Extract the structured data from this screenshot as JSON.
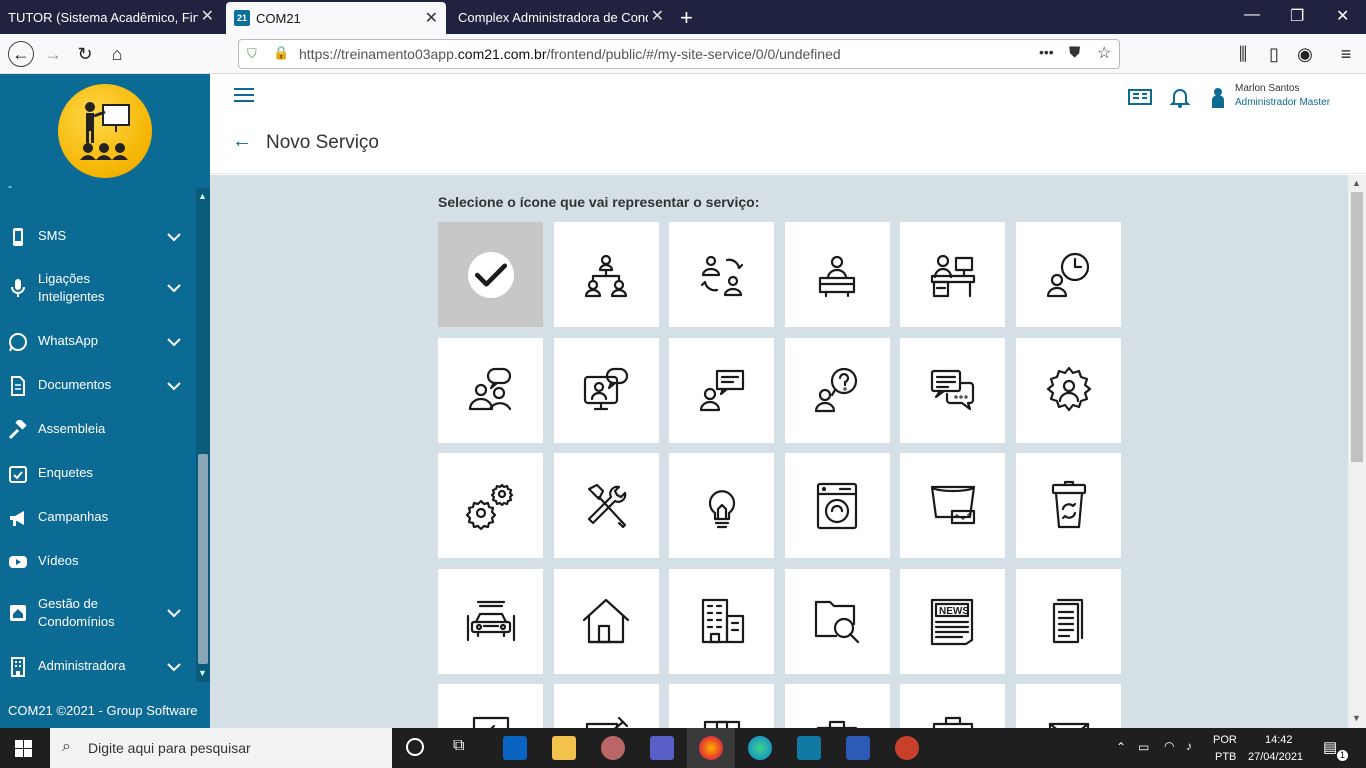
{
  "browser": {
    "tabs": [
      {
        "title": "TUTOR (Sistema Acadêmico, Financ",
        "active": false
      },
      {
        "title": "COM21",
        "active": true,
        "favicon": "21"
      },
      {
        "title": "Complex Administradora de Cond",
        "active": false
      }
    ],
    "url_prefix": "https://treinamento03app.",
    "url_domain": "com21.com.br",
    "url_path": "/frontend/public/#/my-site-service/0/0/undefined",
    "url_more": "•••"
  },
  "sidebar": {
    "items": [
      {
        "label": "SMS",
        "icon": "phone-icon",
        "expandable": true
      },
      {
        "label": "Ligações\nInteligentes",
        "icon": "microphone-icon",
        "expandable": true
      },
      {
        "label": "WhatsApp",
        "icon": "whatsapp-icon",
        "expandable": true
      },
      {
        "label": "Documentos",
        "icon": "document-icon",
        "expandable": true
      },
      {
        "label": "Assembleia",
        "icon": "gavel-icon",
        "expandable": false
      },
      {
        "label": "Enquetes",
        "icon": "calendar-check-icon",
        "expandable": false
      },
      {
        "label": "Campanhas",
        "icon": "megaphone-icon",
        "expandable": false
      },
      {
        "label": "Vídeos",
        "icon": "youtube-icon",
        "expandable": false
      },
      {
        "label": "Gestão de\nCondomínios",
        "icon": "house-icon",
        "expandable": true
      },
      {
        "label": "Administradora",
        "icon": "building-icon",
        "expandable": true
      }
    ],
    "footer": "COM21 ©2021 - Group Software"
  },
  "header": {
    "title": "Novo Serviço",
    "user_name": "Marlon Santos",
    "user_role": "Administrador Master"
  },
  "main": {
    "instruction": "Selecione o ícone que vai representar o serviço:",
    "selected_index": 0,
    "icons": [
      "checkmark-icon",
      "hierarchy-icon",
      "people-exchange-icon",
      "reception-desk-icon",
      "office-desk-icon",
      "person-clock-icon",
      "people-chat-icon",
      "video-support-icon",
      "person-message-icon",
      "person-question-icon",
      "chat-bubbles-icon",
      "gear-person-icon",
      "gears-icon",
      "tools-icon",
      "lightbulb-icon",
      "washing-machine-icon",
      "bucket-sponge-icon",
      "trash-bin-icon",
      "car-wash-icon",
      "house-icon",
      "buildings-icon",
      "folder-search-icon",
      "newspaper-icon",
      "documents-icon",
      "clipboard-icon",
      "pen-paper-icon",
      "box-icon",
      "briefcase-icon",
      "calendar-icon",
      "envelope-icon"
    ]
  },
  "taskbar": {
    "search_placeholder": "Digite aqui para pesquisar",
    "lang1": "POR",
    "lang2": "PTB",
    "time": "14:42",
    "date": "27/04/2021",
    "notif_count": "1"
  }
}
